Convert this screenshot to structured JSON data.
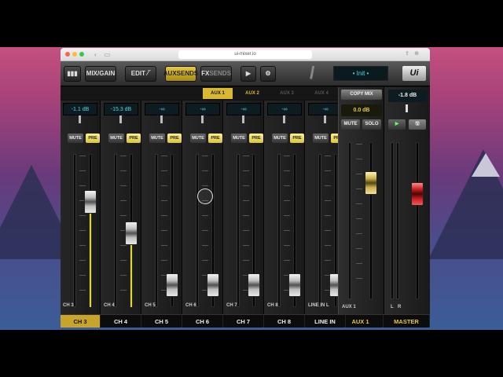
{
  "browser": {
    "url": "ui-mixer.io"
  },
  "toolbar": {
    "mix_gain": "MIX/GAIN",
    "edit": "EDIT",
    "auxsends": "AUXSENDS",
    "fx_a": "FX",
    "fx_b": "SENDS",
    "display": "• Init •",
    "logo": "Ui"
  },
  "aux_tabs": [
    "AUX 1",
    "AUX 2",
    "AUX 3",
    "AUX 4"
  ],
  "strips": [
    {
      "gain": "-1.1 dB",
      "label": "CH 3",
      "name": "CH 3",
      "level": 0.72,
      "lit": true
    },
    {
      "gain": "-15.3 dB",
      "label": "CH 4",
      "name": "CH 4",
      "level": 0.48,
      "lit": true
    },
    {
      "gain": "-∞",
      "label": "CH 5",
      "name": "CH 5",
      "level": 0.08,
      "lit": false
    },
    {
      "gain": "-∞",
      "label": "CH 6",
      "name": "CH 6",
      "level": 0.08,
      "lit": false
    },
    {
      "gain": "-∞",
      "label": "CH 7",
      "name": "CH 7",
      "level": 0.08,
      "lit": false
    },
    {
      "gain": "-∞",
      "label": "CH 8",
      "name": "CH 8",
      "level": 0.08,
      "lit": false
    },
    {
      "gain": "-∞",
      "label": "LINE IN L",
      "name": "LINE IN",
      "level": 0.08,
      "lit": false
    }
  ],
  "strip_buttons": {
    "mute": "MUTE",
    "pre": "PRE"
  },
  "aux_master": {
    "copy_mix": "COPY MIX",
    "gain": "0.0 dB",
    "mute": "MUTE",
    "solo": "SOLO",
    "label": "AUX 1",
    "name": "AUX 1",
    "level": 0.78
  },
  "master": {
    "gain": "-1.8 dB",
    "label_l": "L",
    "label_r": "R",
    "name": "MASTER",
    "level": 0.7
  },
  "colors": {
    "accent": "#e6c93c",
    "display": "#4fd6e6",
    "master_fader": "#c31b1b"
  }
}
